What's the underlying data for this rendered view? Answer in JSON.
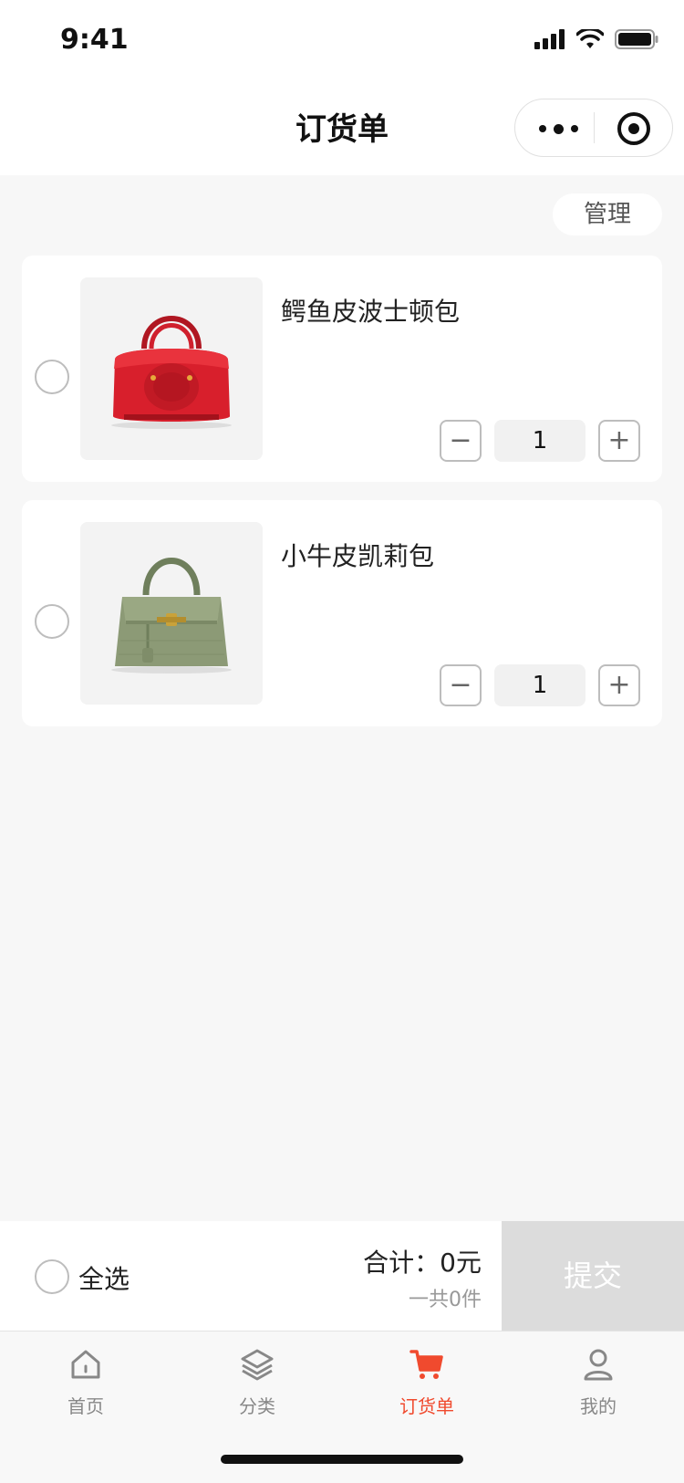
{
  "status_bar": {
    "time": "9:41"
  },
  "nav": {
    "title": "订货单"
  },
  "toolbar": {
    "manage_label": "管理"
  },
  "cart": {
    "items": [
      {
        "name": "鳄鱼皮波士顿包",
        "quantity": "1",
        "minus": "−",
        "plus": "+",
        "image": "red crocodile leather boston bag"
      },
      {
        "name": "小牛皮凯莉包",
        "quantity": "1",
        "minus": "−",
        "plus": "+",
        "image": "green crocodile-embossed kelly bag"
      }
    ]
  },
  "checkout": {
    "select_all_label": "全选",
    "total_text": "合计：0元",
    "count_text": "一共0件",
    "submit_label": "提交"
  },
  "tabbar": {
    "items": [
      {
        "label": "首页",
        "icon": "home-icon"
      },
      {
        "label": "分类",
        "icon": "layers-icon"
      },
      {
        "label": "订货单",
        "icon": "cart-icon",
        "active": true
      },
      {
        "label": "我的",
        "icon": "user-icon"
      }
    ]
  },
  "colors": {
    "accent": "#f04a2e",
    "background": "#f7f7f7",
    "submit_disabled": "#dcdcdc"
  }
}
